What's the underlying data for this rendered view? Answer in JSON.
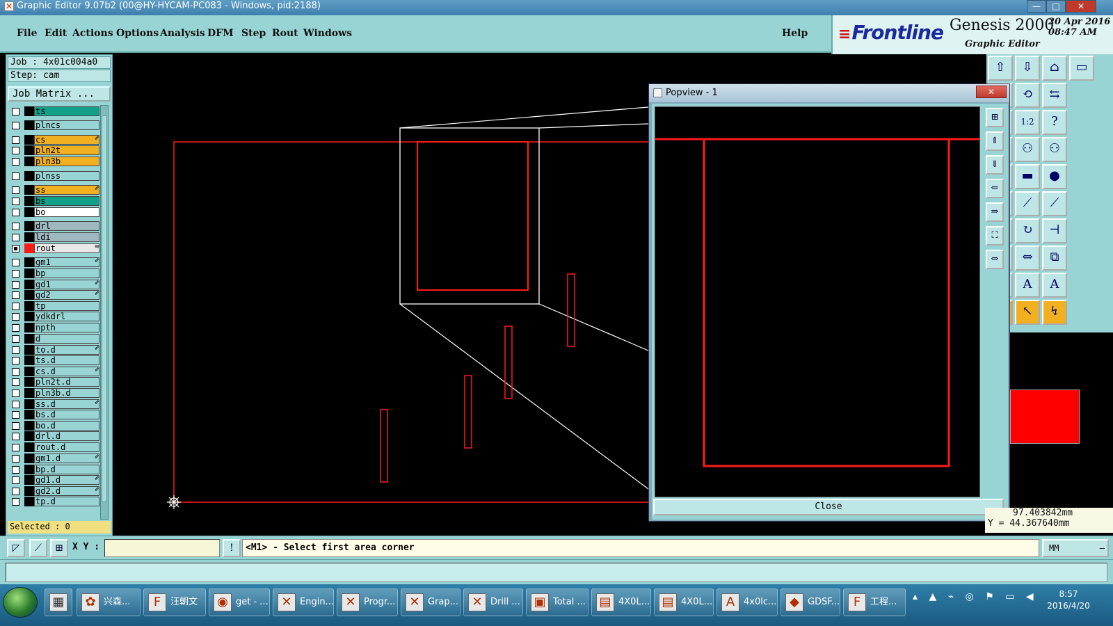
{
  "window": {
    "title": "Graphic Editor 9.07b2 (00@HY-HYCAM-PC083 - Windows, pid:2188)",
    "controls": [
      "—",
      "□",
      "✕"
    ]
  },
  "menu": {
    "items": [
      "File",
      "Edit",
      "Actions",
      "Options",
      "Analysis",
      "DFM",
      "Step",
      "Rout",
      "Windows"
    ],
    "help": "Help"
  },
  "brand": {
    "logo": "Frontline",
    "product": "Genesis 2000",
    "subtitle": "Graphic Editor",
    "date_line1": "20 Apr 2016",
    "date_line2": "08:47 AM"
  },
  "job": {
    "job_label": "Job : 4x01c004a0",
    "step_label": "Step: cam",
    "matrix_button": "Job Matrix ..."
  },
  "layers": [
    {
      "name": "ts",
      "color": "#12a088",
      "arrow": ""
    },
    {
      "name": "plncs",
      "color": "#99d4d4",
      "arrow": ""
    },
    {
      "name": "cs",
      "color": "#f0b020",
      "arrow": "⇙"
    },
    {
      "name": "pln2t",
      "color": "#f0b020",
      "arrow": ""
    },
    {
      "name": "pln3b",
      "color": "#f0b020",
      "arrow": ""
    },
    {
      "name": "plnss",
      "color": "#99d4d4",
      "arrow": ""
    },
    {
      "name": "ss",
      "color": "#f0b020",
      "arrow": "⇙"
    },
    {
      "name": "bs",
      "color": "#12a088",
      "arrow": ""
    },
    {
      "name": "bo",
      "color": "#ffffff",
      "arrow": ""
    },
    {
      "name": "drl",
      "color": "#9fb8c0",
      "arrow": ""
    },
    {
      "name": "ldi",
      "color": "#9fb8c0",
      "arrow": ""
    },
    {
      "name": "rout",
      "color": "#e8e8e8",
      "arrow": "≡"
    },
    {
      "name": "gm1",
      "color": "#99d4d4",
      "arrow": "⇙"
    },
    {
      "name": "bp",
      "color": "#99d4d4",
      "arrow": ""
    },
    {
      "name": "gd1",
      "color": "#99d4d4",
      "arrow": "⇙"
    },
    {
      "name": "gd2",
      "color": "#99d4d4",
      "arrow": "⇙"
    },
    {
      "name": "tp",
      "color": "#99d4d4",
      "arrow": ""
    },
    {
      "name": "ydkdrl",
      "color": "#99d4d4",
      "arrow": ""
    },
    {
      "name": "npth",
      "color": "#99d4d4",
      "arrow": ""
    },
    {
      "name": "d",
      "color": "#99d4d4",
      "arrow": ""
    },
    {
      "name": "to.d",
      "color": "#99d4d4",
      "arrow": "⇙"
    },
    {
      "name": "ts.d",
      "color": "#99d4d4",
      "arrow": ""
    },
    {
      "name": "cs.d",
      "color": "#99d4d4",
      "arrow": "⇙"
    },
    {
      "name": "pln2t.d",
      "color": "#99d4d4",
      "arrow": ""
    },
    {
      "name": "pln3b.d",
      "color": "#99d4d4",
      "arrow": ""
    },
    {
      "name": "ss.d",
      "color": "#99d4d4",
      "arrow": "⇙"
    },
    {
      "name": "bs.d",
      "color": "#99d4d4",
      "arrow": ""
    },
    {
      "name": "bo.d",
      "color": "#99d4d4",
      "arrow": ""
    },
    {
      "name": "drl.d",
      "color": "#99d4d4",
      "arrow": ""
    },
    {
      "name": "rout.d",
      "color": "#99d4d4",
      "arrow": ""
    },
    {
      "name": "gm1.d",
      "color": "#99d4d4",
      "arrow": "⇙"
    },
    {
      "name": "bp.d",
      "color": "#99d4d4",
      "arrow": ""
    },
    {
      "name": "gd1.d",
      "color": "#99d4d4",
      "arrow": "⇙"
    },
    {
      "name": "gd2.d",
      "color": "#99d4d4",
      "arrow": "⇙"
    },
    {
      "name": "tp.d",
      "color": "#99d4d4",
      "arrow": ""
    }
  ],
  "selected_label": "Selected : 0",
  "popview": {
    "title": "Popview - 1",
    "close_label": "Close"
  },
  "coords": {
    "x": "97.403842mm",
    "y": "Y = 44.367640mm"
  },
  "statusbar": {
    "xy_label": "X Y :",
    "xy_value": "",
    "prompt": "<M1> - Select first area corner",
    "units": "MM"
  },
  "taskbar": {
    "items": [
      "兴森...",
      "汪朝文",
      "get - ...",
      "Engin...",
      "Progr...",
      "Grap...",
      "Drill ...",
      "Total ...",
      "4X0L...",
      "4X0L...",
      "4x0lc...",
      "GDSF...",
      "工程..."
    ],
    "time": "8:57",
    "date": "2016/4/20"
  },
  "colors": {
    "panel": "#99d4d4",
    "rout_line": "#ff1a1a",
    "outline": "#ffffff"
  }
}
